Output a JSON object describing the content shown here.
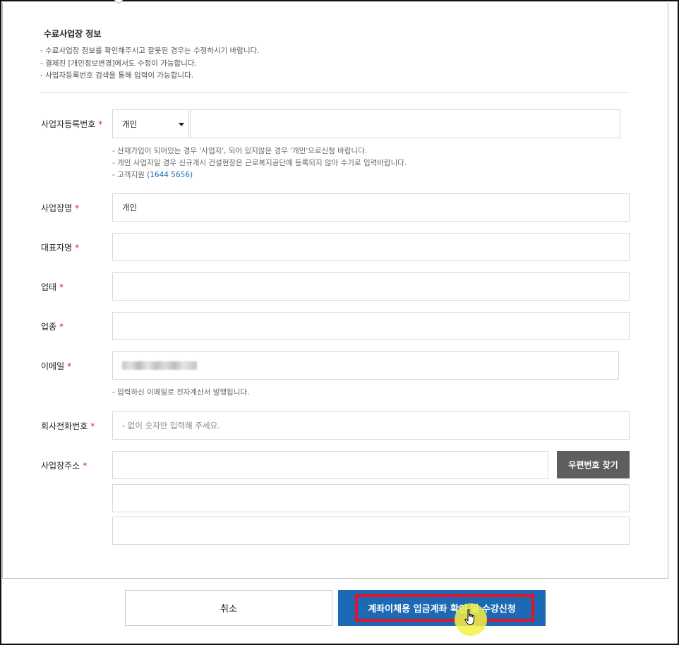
{
  "section": {
    "title": "수료사업장 정보",
    "notes": [
      "- 수료사업장 정보를 확인해주시고 잘못된 경우는 수정하시기 바랍니다.",
      "- 결제진 [개인정보변경]에서도 수정이 가능합니다.",
      "- 사업자등록번호 검색을 통해 입력이 가능합니다."
    ]
  },
  "form": {
    "required_mark": "*",
    "bizno": {
      "label": "사업자등록번호",
      "select_value": "개인",
      "value": "",
      "help": [
        "- 산재가입이 되어있는 경우 '사업자', 되어 있지않은 경우 '개인'으로신청 바랍니다.",
        "- 개인 사업자일 경우 신규개시 건설현장은 근로복지공단에 등록되지 않아 수기로 입력바랍니다."
      ],
      "support_prefix": "- 고객지원",
      "support_phone": "(1644 5656)"
    },
    "bizname": {
      "label": "사업장명",
      "value": "개인"
    },
    "ceo": {
      "label": "대표자명",
      "value": ""
    },
    "biztype": {
      "label": "업태",
      "value": ""
    },
    "bizitem": {
      "label": "업종",
      "value": ""
    },
    "email": {
      "label": "이메일",
      "help": "- 입력하신 이메일로 전자계산서 발행됩니다."
    },
    "phone": {
      "label": "회사전화번호",
      "placeholder": "- 없이 숫자만 입력해 주세요."
    },
    "address": {
      "label": "사업장주소",
      "postcode_button": "우편번호 찾기",
      "line1": "",
      "line2": "",
      "line3": ""
    }
  },
  "actions": {
    "cancel": "취소",
    "submit": "계좌이체용 입금계좌 확인 및 수강신청"
  },
  "colors": {
    "primary": "#1b6ab3",
    "required": "#e02020",
    "highlight": "#e8132a",
    "gray_button": "#5e5e5e"
  }
}
